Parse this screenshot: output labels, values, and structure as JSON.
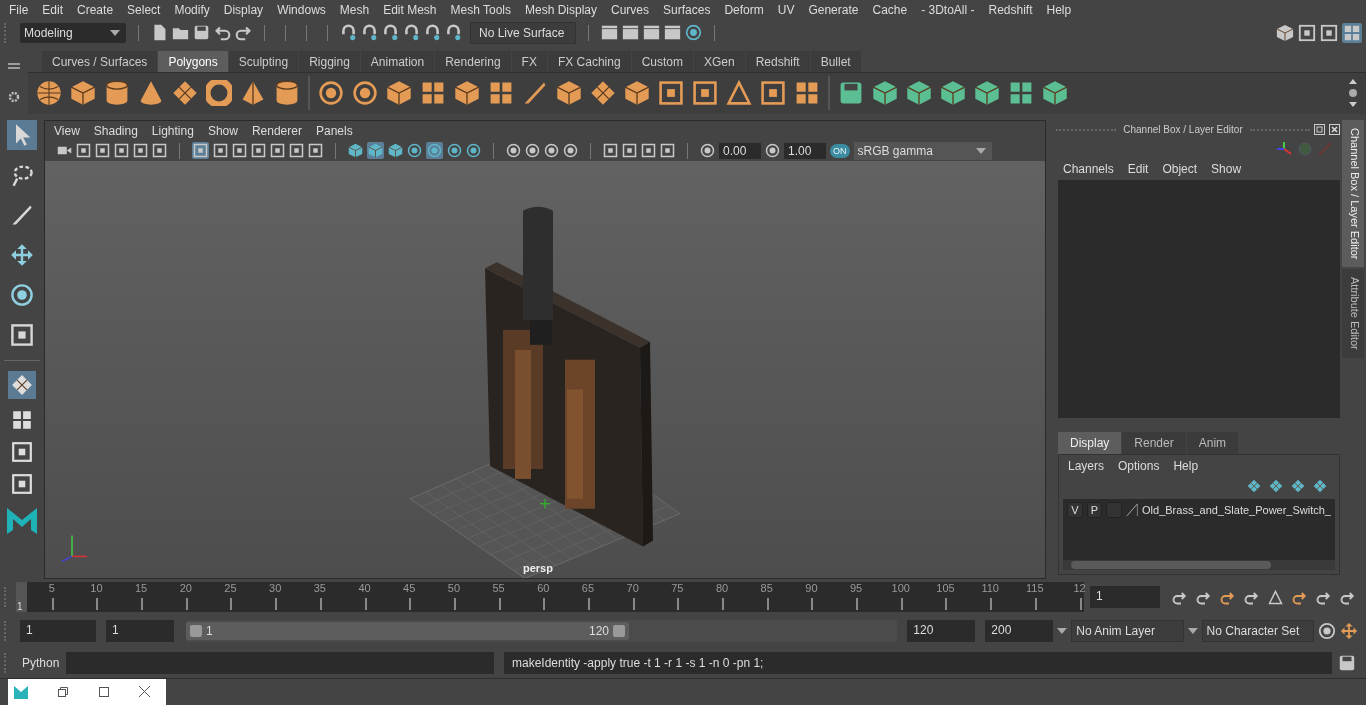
{
  "menu_bar": [
    "File",
    "Edit",
    "Create",
    "Select",
    "Modify",
    "Display",
    "Windows",
    "Mesh",
    "Edit Mesh",
    "Mesh Tools",
    "Mesh Display",
    "Curves",
    "Surfaces",
    "Deform",
    "UV",
    "Generate",
    "Cache",
    "- 3DtoAll -",
    "Redshift",
    "Help"
  ],
  "status_line": {
    "mode": "Modeling",
    "live_surface": "No Live Surface"
  },
  "shelf": {
    "tabs": [
      {
        "label": "Curves / Surfaces",
        "selected": false
      },
      {
        "label": "Polygons",
        "selected": true
      },
      {
        "label": "Sculpting",
        "selected": false
      },
      {
        "label": "Rigging",
        "selected": false
      },
      {
        "label": "Animation",
        "selected": false
      },
      {
        "label": "Rendering",
        "selected": false
      },
      {
        "label": "FX",
        "selected": false
      },
      {
        "label": "FX Caching",
        "selected": false
      },
      {
        "label": "Custom",
        "selected": false
      },
      {
        "label": "XGen",
        "selected": false
      },
      {
        "label": "Redshift",
        "selected": false
      },
      {
        "label": "Bullet",
        "selected": false
      }
    ]
  },
  "viewport": {
    "menu": [
      "View",
      "Shading",
      "Lighting",
      "Show",
      "Renderer",
      "Panels"
    ],
    "exposure": "0.00",
    "gamma": "1.00",
    "color_management": "ON",
    "color_space": "sRGB gamma",
    "camera_label": "persp"
  },
  "channel_box": {
    "title": "Channel Box / Layer Editor",
    "menu": [
      "Channels",
      "Edit",
      "Object",
      "Show"
    ]
  },
  "layer_editor": {
    "tabs": [
      {
        "label": "Display",
        "selected": true
      },
      {
        "label": "Render",
        "selected": false
      },
      {
        "label": "Anim",
        "selected": false
      }
    ],
    "menu": [
      "Layers",
      "Options",
      "Help"
    ],
    "layers": [
      {
        "visible": "V",
        "playback": "P",
        "name": "Old_Brass_and_Slate_Power_Switch_"
      }
    ]
  },
  "side_tabs": [
    {
      "label": "Channel Box / Layer Editor",
      "selected": true
    },
    {
      "label": "Attribute Editor",
      "selected": false
    }
  ],
  "timeline": {
    "tick_labels": [
      "5",
      "10",
      "15",
      "20",
      "25",
      "30",
      "35",
      "40",
      "45",
      "50",
      "55",
      "60",
      "65",
      "70",
      "75",
      "80",
      "85",
      "90",
      "95",
      "100",
      "105",
      "110",
      "115",
      "12"
    ],
    "current_frame": "1",
    "level": 0,
    "frame_field": "1"
  },
  "range": {
    "start": "1",
    "playback_start": "1",
    "slider_start": "1",
    "slider_end": "120",
    "level": 1,
    "playback_end": "120",
    "end": "200",
    "anim_layer": "No Anim Layer",
    "character_set": "No Character Set"
  },
  "command_line": {
    "language": "Python",
    "result": "makeIdentity -apply true -t 1 -r 1 -s 1 -n 0 -pn 1;"
  }
}
